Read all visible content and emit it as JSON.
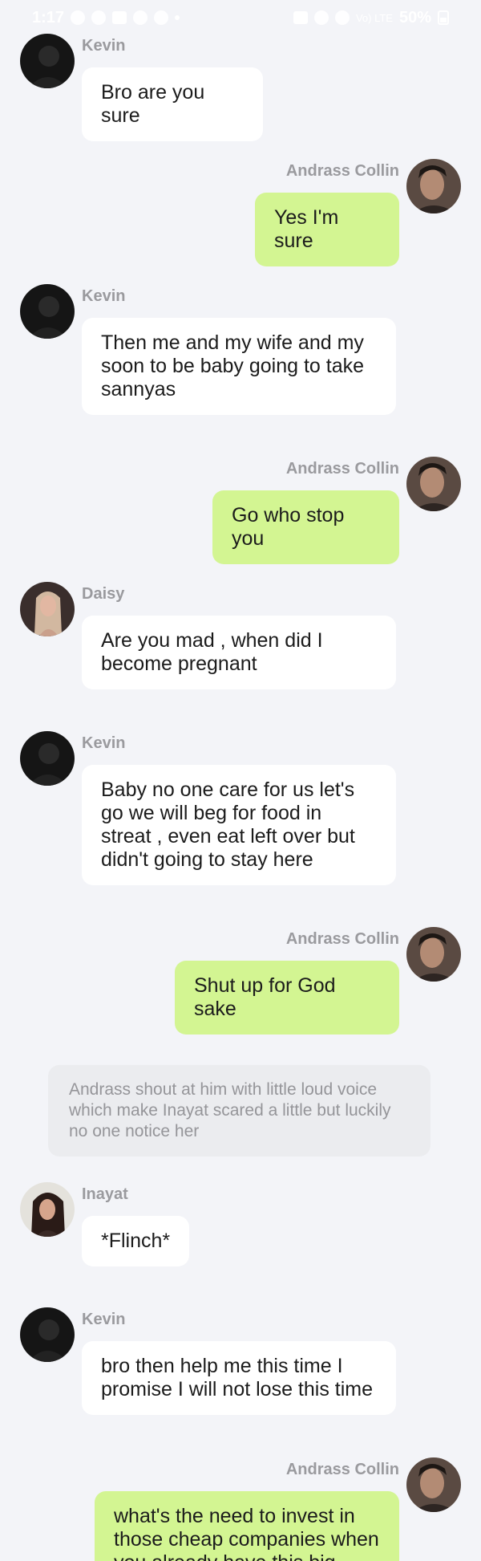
{
  "status_bar": {
    "time": "1:17",
    "network": "Vo) LTE",
    "battery": "50%"
  },
  "messages": [
    {
      "sender": "Kevin",
      "text": "Bro are you sure",
      "side": "left",
      "avatar": "kevin-avatar"
    },
    {
      "sender": "Andrass Collin",
      "text": "Yes I'm sure",
      "side": "right",
      "avatar": "andrass-avatar"
    },
    {
      "sender": "Kevin",
      "text": "Then me and my wife and my soon to be baby going to take sannyas",
      "side": "left",
      "avatar": "kevin-avatar"
    },
    {
      "sender": "Andrass Collin",
      "text": "Go who stop you",
      "side": "right",
      "avatar": "andrass-avatar"
    },
    {
      "sender": "Daisy",
      "text": "Are you mad , when did I become pregnant",
      "side": "left",
      "avatar": "daisy-avatar"
    },
    {
      "sender": "Kevin",
      "text": "Baby no one care for us let's go we will beg for food in streat , even eat left over but didn't going to stay here",
      "side": "left",
      "avatar": "kevin-avatar"
    },
    {
      "sender": "Andrass Collin",
      "text": "Shut up for God sake",
      "side": "right",
      "avatar": "andrass-avatar"
    },
    {
      "sender": "Inayat",
      "text": "*Flinch*",
      "side": "left",
      "avatar": "inayat-avatar"
    },
    {
      "sender": "Kevin",
      "text": "bro then help me this time I promise I will not lose this time",
      "side": "left",
      "avatar": "kevin-avatar"
    },
    {
      "sender": "Andrass Collin",
      "text": "what's the need to invest in those cheap companies when you already have this big",
      "side": "right",
      "avatar": "andrass-avatar"
    }
  ],
  "narration": "Andrass shout at him with little loud voice which make Inayat scared a little but luckily no one notice her",
  "colors": {
    "background": "#f3f4f8",
    "left_bubble": "#ffffff",
    "right_bubble": "#d3f592",
    "name_text": "#9a9a9e",
    "narration_bg": "#ebecef"
  }
}
